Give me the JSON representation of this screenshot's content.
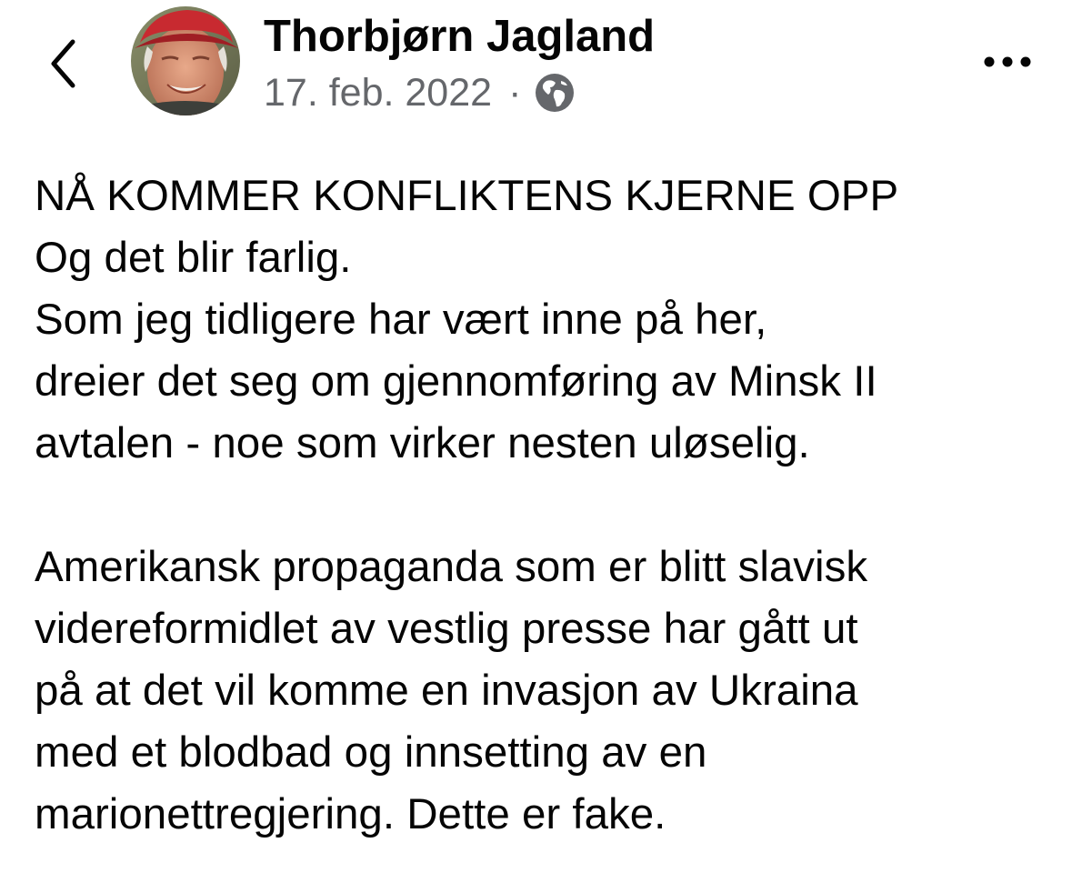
{
  "header": {
    "back_icon": "chevron-left-icon",
    "author_name": "Thorbjørn Jagland",
    "date": "17. feb. 2022",
    "separator": "·",
    "privacy_icon": "globe-icon",
    "more_icon": "ellipsis-icon"
  },
  "post": {
    "paragraph1": [
      "NÅ KOMMER KONFLIKTENS KJERNE OPP",
      "Og det blir farlig.",
      "Som jeg tidligere har vært inne på her,",
      "dreier det seg om gjennomføring av Minsk II",
      "avtalen - noe som virker nesten uløselig."
    ],
    "paragraph2": [
      "Amerikansk propaganda som er blitt slavisk",
      "videreformidlet av vestlig presse har gått ut",
      "på at det vil komme en invasjon av Ukraina",
      "med et blodbad og innsetting av en",
      "marionettregjering.  Dette er fake."
    ]
  },
  "colors": {
    "text": "#050505",
    "secondary_text": "#65676b",
    "background": "#ffffff"
  }
}
